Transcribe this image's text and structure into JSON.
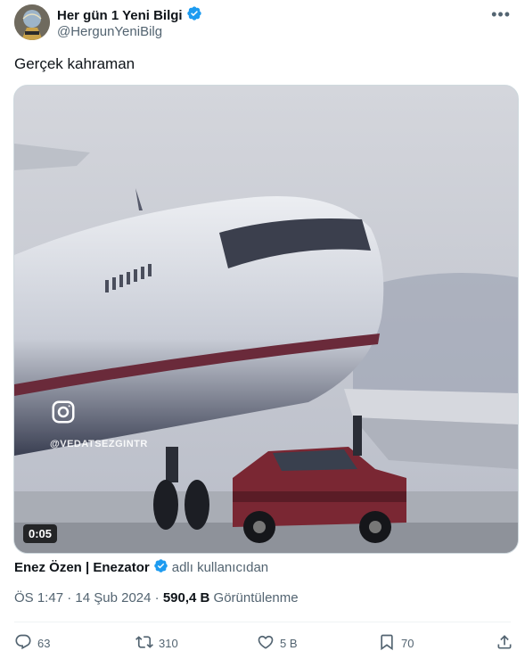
{
  "author": {
    "display_name": "Her gün 1 Yeni Bilgi",
    "handle": "@HergunYeniBilg",
    "verified": true
  },
  "tweet": {
    "text": "Gerçek kahraman"
  },
  "media": {
    "duration": "0:05",
    "watermark": "@VEDATSEZGINTR",
    "watermark_icon": "instagram-icon"
  },
  "attribution": {
    "name": "Enez Özen | Enezator",
    "suffix": "adlı kullanıcıdan",
    "verified": true
  },
  "meta": {
    "time": "ÖS 1:47",
    "separator": "·",
    "date": "14 Şub 2024",
    "views": "590,4 B",
    "views_label": "Görüntülenme"
  },
  "actions": {
    "replies": "63",
    "reposts": "310",
    "likes": "5 B",
    "bookmarks": "70"
  },
  "colors": {
    "verified_blue": "#1d9bf0",
    "text_primary": "#0f1419",
    "text_secondary": "#536471"
  }
}
